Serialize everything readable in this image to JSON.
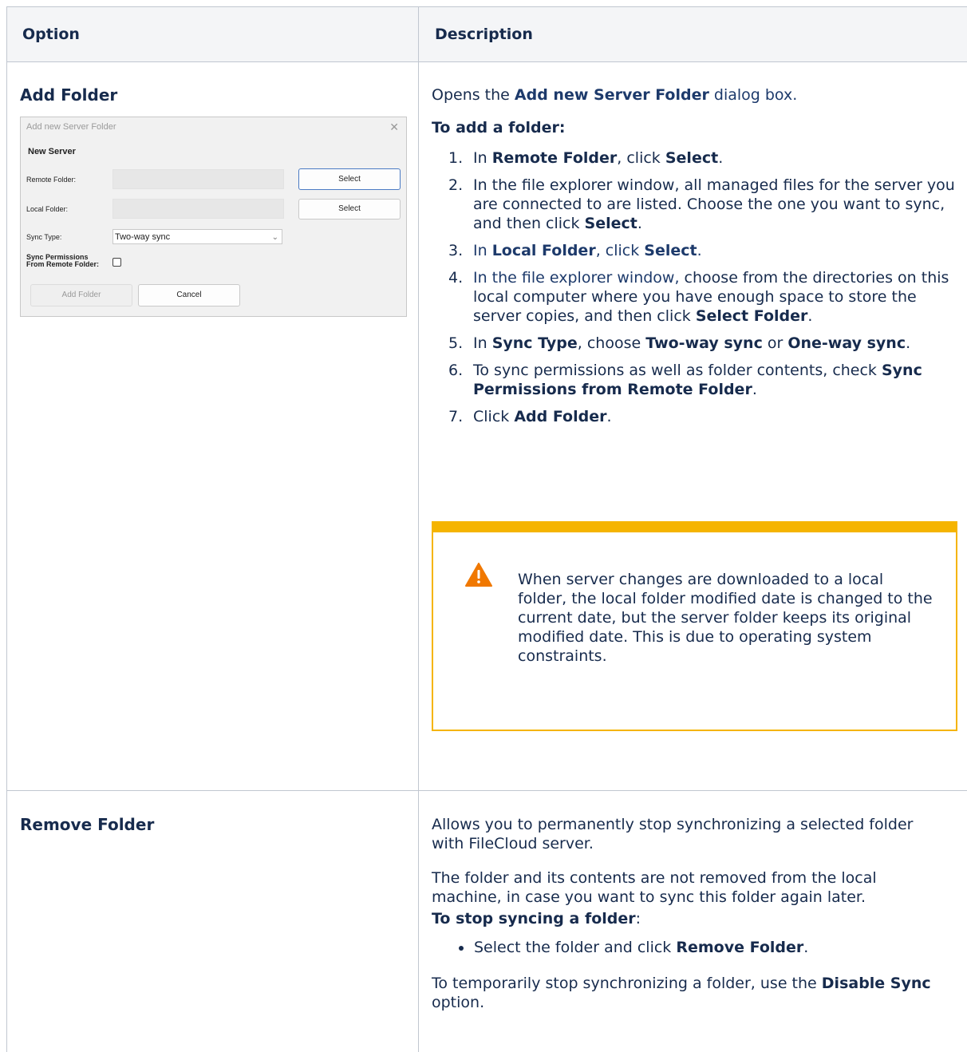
{
  "table": {
    "headers": [
      "Option",
      "Description"
    ]
  },
  "add_folder": {
    "option": "Add Folder",
    "intro": {
      "pre": "Opens the ",
      "bold": "Add new Server Folder",
      "post": " dialog box."
    },
    "subheading": "To add a folder:",
    "steps": [
      {
        "num": "1.",
        "parts": [
          [
            "In ",
            false
          ],
          [
            "Remote Folder",
            true
          ],
          [
            ", click ",
            false
          ],
          [
            "Select",
            true
          ],
          [
            ".",
            false
          ]
        ]
      },
      {
        "num": "2.",
        "parts": [
          [
            "In the file explorer window, all managed files for the server you are connected to are listed. Choose the one you want to sync, and then click ",
            false
          ],
          [
            "Select",
            true
          ],
          [
            ".",
            false
          ]
        ]
      },
      {
        "num": "3.",
        "parts": [
          [
            "In ",
            false
          ],
          [
            "Local Folder",
            true
          ],
          [
            ", click ",
            false
          ],
          [
            "Select",
            true
          ],
          [
            ".",
            false
          ]
        ]
      },
      {
        "num": "4.",
        "parts": [
          [
            "In the file explorer window,",
            false
          ],
          [
            " choose from the directories on this local computer where you have enough space to store the server copies, and then click ",
            false
          ],
          [
            "Select Folder",
            true
          ],
          [
            ".",
            false
          ]
        ]
      },
      {
        "num": "5.",
        "parts": [
          [
            "In ",
            false
          ],
          [
            "Sync Type",
            true
          ],
          [
            ", choose ",
            false
          ],
          [
            "Two-way sync",
            true
          ],
          [
            " or ",
            false
          ],
          [
            "One-way sync",
            true
          ],
          [
            ".",
            false
          ]
        ]
      },
      {
        "num": "6.",
        "parts": [
          [
            "To sync permissions as well as folder contents, check ",
            false
          ],
          [
            "Sync Permissions from Remote Folder",
            true
          ],
          [
            ".",
            false
          ]
        ]
      },
      {
        "num": "7.",
        "parts": [
          [
            "Click ",
            false
          ],
          [
            "Add Folder",
            true
          ],
          [
            ".",
            false
          ]
        ]
      }
    ],
    "warning": "When server changes are downloaded to a local folder, the local folder modified date is changed to the current date, but the server folder keeps its original modified date. This is due to operating system constraints.",
    "dialog": {
      "title": "Add new Server Folder",
      "heading": "New Server",
      "remote_label": "Remote Folder:",
      "local_label": "Local Folder:",
      "sync_type_label": "Sync Type:",
      "sync_type_value": "Two-way sync",
      "perm_label_1": "Sync Permissions",
      "perm_label_2": "From Remote Folder:",
      "select_label": "Select",
      "add_label": "Add Folder",
      "cancel_label": "Cancel"
    }
  },
  "remove_folder": {
    "option": "Remove Folder",
    "p1": "Allows you to permanently stop synchronizing a selected folder with FileCloud server.",
    "p2": "The folder and its contents are not removed from the local machine, in case you want to sync this folder again later.",
    "sub_bold": "To stop syncing a folder",
    "sub_tail": ":",
    "bullet_pre": "Select the folder and click ",
    "bullet_bold": "Remove Folder",
    "bullet_post": ".",
    "p3_pre": "To temporarily stop synchronizing a folder, use the ",
    "p3_bold": "Disable Sync",
    "p3_post": " option."
  },
  "colors": {
    "warning": "#f5b400",
    "text": "#172b4d",
    "heading_blue": "#1d3a6b",
    "border": "#c1c7d0",
    "header_bg": "#f4f5f7"
  }
}
